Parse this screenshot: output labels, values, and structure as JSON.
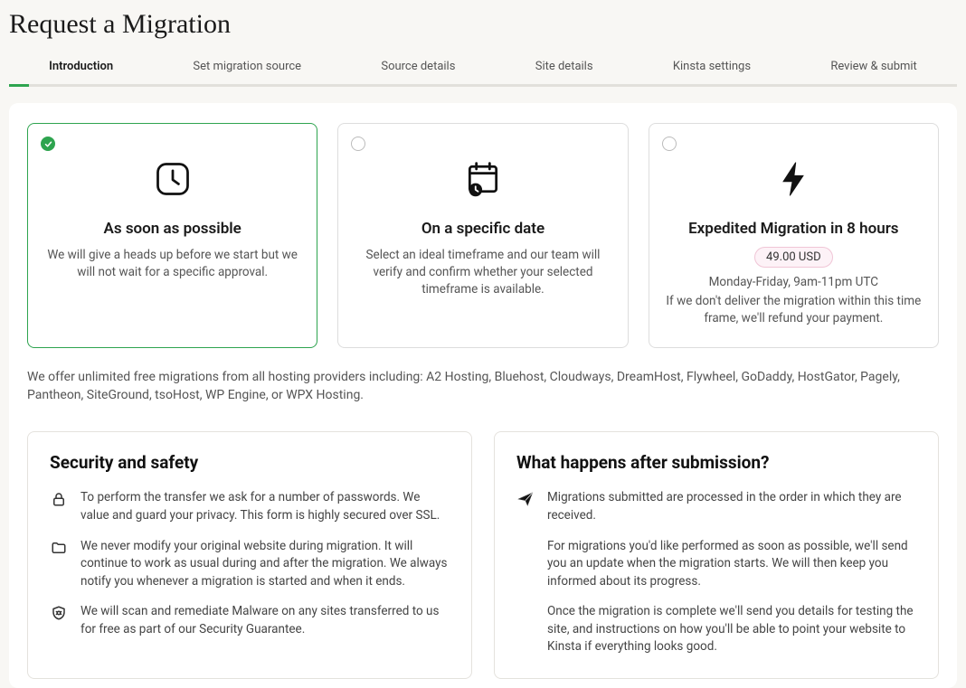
{
  "page": {
    "title": "Request a Migration"
  },
  "tabs": {
    "items": [
      {
        "label": "Introduction"
      },
      {
        "label": "Set migration source"
      },
      {
        "label": "Source details"
      },
      {
        "label": "Site details"
      },
      {
        "label": "Kinsta settings"
      },
      {
        "label": "Review & submit"
      }
    ],
    "active_index": 0
  },
  "options": {
    "asap": {
      "title": "As soon as possible",
      "desc": "We will give a heads up before we start but we will not wait for a specific approval."
    },
    "specific": {
      "title": "On a specific date",
      "desc": "Select an ideal timeframe and our team will verify and confirm whether your selected timeframe is available."
    },
    "expedited": {
      "title": "Expedited Migration in 8 hours",
      "price": "49.00 USD",
      "hours": "Monday-Friday, 9am-11pm UTC",
      "desc": "If we don't deliver the migration within this time frame, we'll refund your payment."
    }
  },
  "intro_note": "We offer unlimited free migrations from all hosting providers including: A2 Hosting, Bluehost, Cloudways, DreamHost, Flywheel, GoDaddy, HostGator, Pagely, Pantheon, SiteGround, tsoHost, WP Engine, or WPX Hosting.",
  "security": {
    "heading": "Security and safety",
    "items": [
      "To perform the transfer we ask for a number of passwords. We value and guard your privacy. This form is highly secured over SSL.",
      "We never modify your original website during migration. It will continue to work as usual during and after the migration. We always notify you whenever a migration is started and when it ends.",
      "We will scan and remediate Malware on any sites transferred to us for free as part of our Security Guarantee."
    ]
  },
  "after": {
    "heading": "What happens after submission?",
    "paragraphs": [
      "Migrations submitted are processed in the order in which they are received.",
      "For migrations you'd like performed as soon as possible, we'll send you an update when the migration starts. We will then keep you informed about its progress.",
      "Once the migration is complete we'll send you details for testing the site, and instructions on how you'll be able to point your website to Kinsta if everything looks good."
    ]
  }
}
